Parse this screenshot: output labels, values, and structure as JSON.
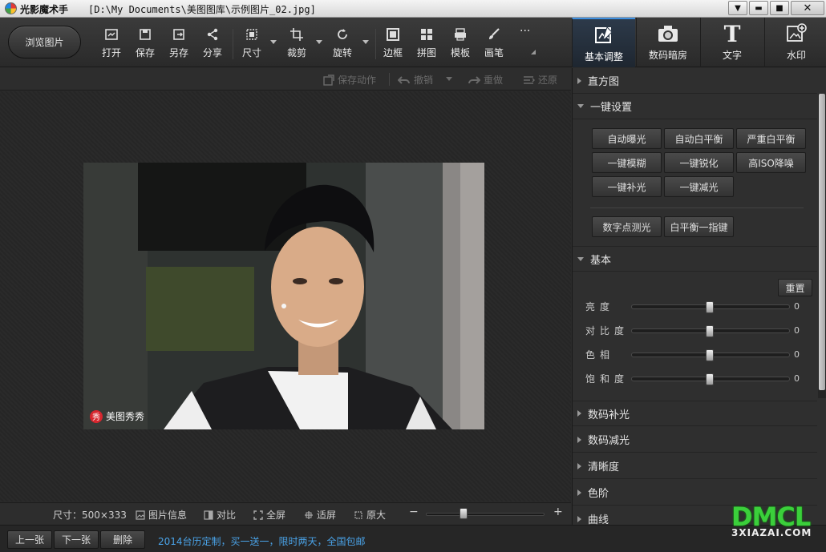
{
  "window": {
    "app_name": "光影魔术手",
    "file_path": "[D:\\My Documents\\美图图库\\示例图片_02.jpg]",
    "controls": {
      "menu": "▼",
      "minimize": "▬",
      "maximize": "■",
      "close": "✕"
    }
  },
  "toolbar": {
    "browse": "浏览图片",
    "tools": [
      {
        "label": "打开",
        "icon": "open-icon"
      },
      {
        "label": "保存",
        "icon": "save-icon"
      },
      {
        "label": "另存",
        "icon": "save-as-icon"
      },
      {
        "label": "分享",
        "icon": "share-icon"
      },
      {
        "label": "尺寸",
        "icon": "resize-icon"
      },
      {
        "label": "裁剪",
        "icon": "crop-icon"
      },
      {
        "label": "旋转",
        "icon": "rotate-icon"
      },
      {
        "label": "边框",
        "icon": "border-icon"
      },
      {
        "label": "拼图",
        "icon": "collage-icon"
      },
      {
        "label": "模板",
        "icon": "template-icon"
      },
      {
        "label": "画笔",
        "icon": "brush-icon"
      },
      {
        "label": "···",
        "icon": "more-icon"
      }
    ],
    "right_tabs": [
      {
        "label": "基本调整",
        "icon": "adjust-icon",
        "active": true
      },
      {
        "label": "数码暗房",
        "icon": "camera-icon",
        "active": false
      },
      {
        "label": "文字",
        "icon": "text-icon",
        "active": false
      },
      {
        "label": "水印",
        "icon": "watermark-icon",
        "active": false
      }
    ]
  },
  "actions": {
    "save_action": "保存动作",
    "undo": "撤销",
    "redo": "重做",
    "restore": "还原"
  },
  "photo": {
    "watermark_badge": "秀",
    "watermark_text": "美图秀秀"
  },
  "statusbar": {
    "size": "尺寸：500×333",
    "info": "图片信息",
    "compare": "对比",
    "fullscreen": "全屏",
    "fit": "适屏",
    "original": "原大",
    "zoom_minus": "−",
    "zoom_plus": "+"
  },
  "bottombar": {
    "prev": "上一张",
    "next": "下一张",
    "delete": "删除",
    "promo": "2014台历定制，买一送一，限时两天，全国包邮"
  },
  "panel": {
    "histogram": "直方图",
    "one_click": "一键设置",
    "one_click_buttons": [
      "自动曝光",
      "自动白平衡",
      "严重白平衡",
      "一键模糊",
      "一键锐化",
      "高ISO降噪",
      "一键补光",
      "一键减光"
    ],
    "extra_buttons": [
      "数字点测光",
      "白平衡一指键"
    ],
    "basic": "基本",
    "reset": "重置",
    "adjustments": [
      {
        "label": "亮度",
        "value": "0"
      },
      {
        "label": "对比度",
        "value": "0"
      },
      {
        "label": "色相",
        "value": "0"
      },
      {
        "label": "饱和度",
        "value": "0"
      }
    ],
    "sections": [
      "数码补光",
      "数码减光",
      "清晰度",
      "色阶",
      "曲线"
    ]
  },
  "site_watermark": {
    "big": "DMCL",
    "small": "3XIAZAI.COM"
  }
}
